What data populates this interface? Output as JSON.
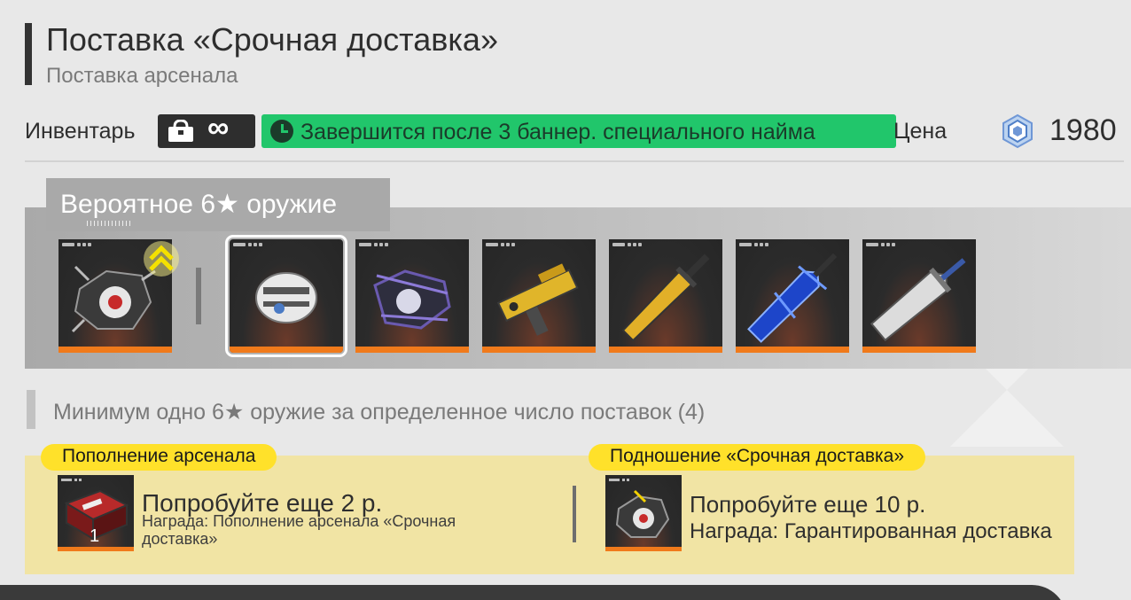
{
  "header": {
    "title": "Поставка «Срочная доставка»",
    "subtitle": "Поставка арсенала"
  },
  "inventory": {
    "label": "Инвентарь",
    "value": "∞",
    "timer_text": "Завершится после 3 баннер. специального найма",
    "timer_color": "#21c66b"
  },
  "price": {
    "label": "Цена",
    "value": "1980",
    "icon": "currency-crystal-icon"
  },
  "weapons": {
    "tab_label": "Вероятное 6★ оружие",
    "items": [
      {
        "name": "weapon-featured",
        "icon": "gauntlet-icon"
      },
      {
        "name": "weapon-1",
        "icon": "gauntlet-white-icon",
        "selected": true
      },
      {
        "name": "weapon-2",
        "icon": "gauntlet-purple-icon"
      },
      {
        "name": "weapon-3",
        "icon": "gun-yellow-icon"
      },
      {
        "name": "weapon-4",
        "icon": "sword-yellow-icon"
      },
      {
        "name": "weapon-5",
        "icon": "sword-blue-icon"
      },
      {
        "name": "weapon-6",
        "icon": "sword-silver-icon"
      }
    ]
  },
  "guarantee_text": "Минимум одно 6★ оружие  за определенное число поставок (4)",
  "rewards": {
    "left": {
      "pill": "Пополнение арсенала",
      "title": "Попробуйте еще 2 р.",
      "subtitle": "Награда: Пополнение арсенала «Срочная доставка»",
      "qty": "1"
    },
    "right": {
      "pill": "Подношение «Срочная доставка»",
      "title": "Попробуйте еще 10 р.",
      "subtitle": "Награда: Гарантированная доставка"
    }
  },
  "colors": {
    "accent_orange": "#f07a1b",
    "pill_yellow": "#ffe12a",
    "reward_bg": "#f1e4a4"
  }
}
